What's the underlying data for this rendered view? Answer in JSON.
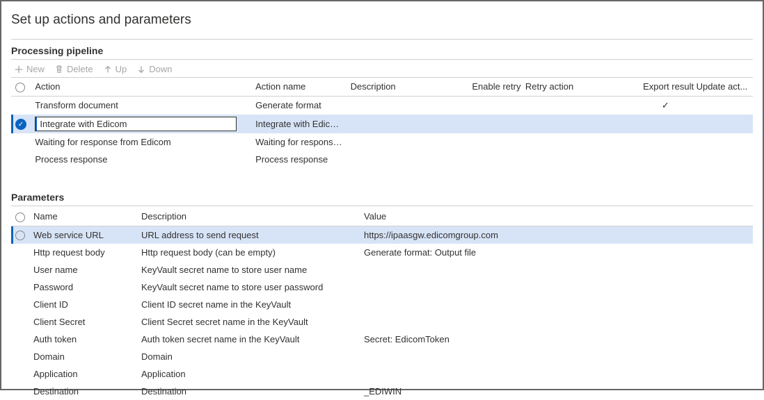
{
  "title": "Set up actions and parameters",
  "pipeline": {
    "title": "Processing pipeline",
    "toolbar": {
      "new": "New",
      "delete": "Delete",
      "up": "Up",
      "down": "Down"
    },
    "columns": {
      "action": "Action",
      "name": "Action name",
      "description": "Description",
      "enable_retry": "Enable retry",
      "retry_action": "Retry action",
      "export_result": "Export result",
      "update_act": "Update act..."
    },
    "rows": [
      {
        "action": "Transform document",
        "name": "Generate format",
        "description": "",
        "export_result": true,
        "selected": false
      },
      {
        "action": "Integrate with Edicom",
        "name": "Integrate with Edicom",
        "description": "",
        "export_result": false,
        "selected": true
      },
      {
        "action": "Waiting for response from Edicom",
        "name": "Waiting for response fro...",
        "description": "",
        "export_result": false,
        "selected": false
      },
      {
        "action": "Process response",
        "name": "Process response",
        "description": "",
        "export_result": false,
        "selected": false
      }
    ]
  },
  "parameters": {
    "title": "Parameters",
    "columns": {
      "name": "Name",
      "description": "Description",
      "value": "Value"
    },
    "rows": [
      {
        "name": "Web service URL",
        "description": "URL address to send request",
        "value": "https://ipaasgw.edicomgroup.com",
        "selected": true
      },
      {
        "name": "Http request body",
        "description": "Http request body (can be empty)",
        "value": "Generate format: Output file",
        "selected": false
      },
      {
        "name": "User name",
        "description": "KeyVault secret name to store user name",
        "value": "",
        "selected": false
      },
      {
        "name": "Password",
        "description": "KeyVault secret name to store user password",
        "value": "",
        "selected": false
      },
      {
        "name": "Client ID",
        "description": "Client ID secret name in the KeyVault",
        "value": "",
        "selected": false
      },
      {
        "name": "Client Secret",
        "description": "Client Secret secret name in the KeyVault",
        "value": "",
        "selected": false
      },
      {
        "name": "Auth token",
        "description": "Auth token secret name in the KeyVault",
        "value": "Secret:  EdicomToken",
        "selected": false
      },
      {
        "name": "Domain",
        "description": "Domain",
        "value": "",
        "selected": false
      },
      {
        "name": "Application",
        "description": "Application",
        "value": "",
        "selected": false
      },
      {
        "name": "Destination",
        "description": "Destination",
        "value": "_EDIWIN",
        "selected": false
      }
    ]
  }
}
